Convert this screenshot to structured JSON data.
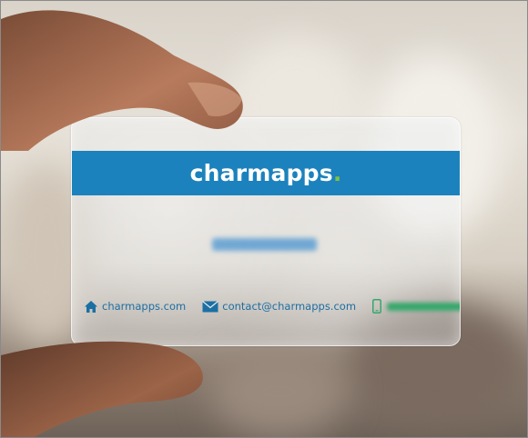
{
  "card": {
    "brand_name": "charmapps",
    "brand_dot": ".",
    "website": "charmapps.com",
    "email": "contact@charmapps.com",
    "icons": [
      "home-icon",
      "envelope-icon",
      "phone-icon"
    ]
  },
  "colors": {
    "brand_band": "#1c82bd",
    "brand_dot": "#7fc241",
    "contact_text": "#1b6fa3",
    "phone_icon": "#35a86b"
  }
}
